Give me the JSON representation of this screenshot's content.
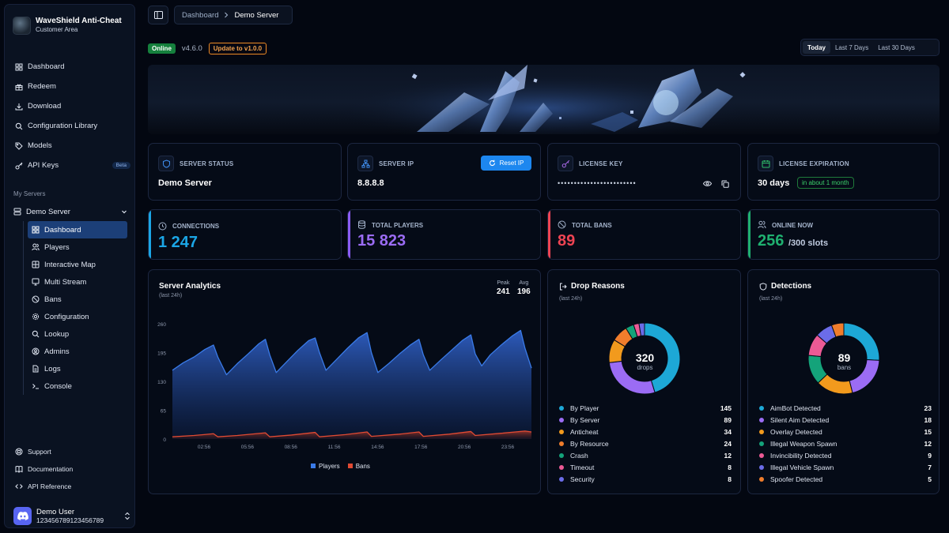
{
  "brand": {
    "title": "WaveShield Anti-Cheat",
    "subtitle": "Customer Area"
  },
  "nav": [
    {
      "label": "Dashboard",
      "icon": "dashboard-icon"
    },
    {
      "label": "Redeem",
      "icon": "gift-icon"
    },
    {
      "label": "Download",
      "icon": "download-icon"
    },
    {
      "label": "Configuration Library",
      "icon": "search-icon"
    },
    {
      "label": "Models",
      "icon": "tag-icon"
    },
    {
      "label": "API Keys",
      "icon": "key-icon",
      "badge": "Beta"
    }
  ],
  "servers": {
    "section_label": "My Servers",
    "server_name": "Demo Server",
    "items": [
      {
        "label": "Dashboard",
        "active": true
      },
      {
        "label": "Players"
      },
      {
        "label": "Interactive Map"
      },
      {
        "label": "Multi Stream"
      },
      {
        "label": "Bans"
      },
      {
        "label": "Configuration"
      },
      {
        "label": "Lookup"
      },
      {
        "label": "Admins"
      },
      {
        "label": "Logs"
      },
      {
        "label": "Console"
      }
    ]
  },
  "bottom_links": [
    {
      "label": "Support"
    },
    {
      "label": "Documentation"
    },
    {
      "label": "API Reference"
    }
  ],
  "user": {
    "name": "Demo User",
    "id": "123456789123456789"
  },
  "breadcrumb": {
    "parent": "Dashboard",
    "current": "Demo Server"
  },
  "status": {
    "online": "Online",
    "version": "v4.6.0",
    "update": "Update to v1.0.0"
  },
  "range": {
    "options": [
      "Today",
      "Last 7 Days",
      "Last 30 Days"
    ],
    "selected": "Today"
  },
  "info_cards": {
    "server_status": {
      "label": "SERVER STATUS",
      "value": "Demo Server"
    },
    "server_ip": {
      "label": "SERVER IP",
      "value": "8.8.8.8",
      "button": "Reset IP"
    },
    "license_key": {
      "label": "LICENSE KEY",
      "masked": "••••••••••••••••••••••••"
    },
    "license_expiration": {
      "label": "LICENSE EXPIRATION",
      "value": "30 days",
      "badge": "in about 1 month"
    }
  },
  "stats": {
    "connections": {
      "label": "CONNECTIONS",
      "value": "1 247",
      "color": "#1ba6e6"
    },
    "total_players": {
      "label": "TOTAL PLAYERS",
      "value": "15 823",
      "color": "#8b5cf6"
    },
    "total_bans": {
      "label": "TOTAL BANS",
      "value": "89",
      "color": "#ef4453"
    },
    "online_now": {
      "label": "ONLINE NOW",
      "value": "256",
      "suffix": "/300 slots",
      "color": "#1fb070"
    }
  },
  "analytics": {
    "title": "Server Analytics",
    "subtitle": "(last 24h)",
    "peak_label": "Peak",
    "peak_value": "241",
    "avg_label": "Avg",
    "avg_value": "196"
  },
  "drop_reasons": {
    "title": "Drop Reasons",
    "subtitle": "(last 24h)",
    "center_value": "320",
    "center_label": "drops",
    "items": [
      {
        "label": "By Player",
        "value": 145,
        "color": "#1da8d6"
      },
      {
        "label": "By Server",
        "value": 89,
        "color": "#9b6cf4"
      },
      {
        "label": "Anticheat",
        "value": 34,
        "color": "#f29a1d"
      },
      {
        "label": "By Resource",
        "value": 24,
        "color": "#f07d2c"
      },
      {
        "label": "Crash",
        "value": 12,
        "color": "#14a37a"
      },
      {
        "label": "Timeout",
        "value": 8,
        "color": "#ec5a95"
      },
      {
        "label": "Security",
        "value": 8,
        "color": "#6b6ce8"
      }
    ]
  },
  "detections": {
    "title": "Detections",
    "subtitle": "(last 24h)",
    "center_value": "89",
    "center_label": "bans",
    "items": [
      {
        "label": "AimBot Detected",
        "value": 23,
        "color": "#1da8d6"
      },
      {
        "label": "Silent Aim Detected",
        "value": 18,
        "color": "#9b6cf4"
      },
      {
        "label": "Overlay Detected",
        "value": 15,
        "color": "#f29a1d"
      },
      {
        "label": "Illegal Weapon Spawn",
        "value": 12,
        "color": "#14a37a"
      },
      {
        "label": "Invincibility Detected",
        "value": 9,
        "color": "#ec5a95"
      },
      {
        "label": "Illegal Vehicle Spawn",
        "value": 7,
        "color": "#6b6ce8"
      },
      {
        "label": "Spoofer Detected",
        "value": 5,
        "color": "#f07d2c"
      }
    ]
  },
  "chart_data": [
    {
      "type": "area",
      "x": [
        "02:56",
        "05:56",
        "08:56",
        "11:56",
        "14:56",
        "17:56",
        "20:56",
        "23:56"
      ],
      "yticks": [
        0,
        65,
        130,
        195,
        260
      ],
      "ylim": [
        0,
        260
      ],
      "legend": "bottom",
      "series": [
        {
          "name": "Players",
          "color": "#3a7be8",
          "points": [
            [
              0,
              155
            ],
            [
              0.5,
              172
            ],
            [
              1,
              185
            ],
            [
              1.5,
              202
            ],
            [
              1.9,
              212
            ],
            [
              2.1,
              185
            ],
            [
              2.5,
              145
            ],
            [
              3,
              170
            ],
            [
              3.5,
              192
            ],
            [
              4,
              215
            ],
            [
              4.3,
              225
            ],
            [
              4.5,
              190
            ],
            [
              4.8,
              150
            ],
            [
              5.3,
              175
            ],
            [
              5.8,
              200
            ],
            [
              6.3,
              222
            ],
            [
              6.6,
              228
            ],
            [
              6.8,
              195
            ],
            [
              7.1,
              155
            ],
            [
              7.6,
              180
            ],
            [
              8.1,
              205
            ],
            [
              8.6,
              228
            ],
            [
              9,
              240
            ],
            [
              9.2,
              195
            ],
            [
              9.5,
              150
            ],
            [
              10,
              170
            ],
            [
              10.5,
              192
            ],
            [
              11,
              212
            ],
            [
              11.4,
              225
            ],
            [
              11.6,
              190
            ],
            [
              11.9,
              155
            ],
            [
              12.4,
              178
            ],
            [
              12.9,
              200
            ],
            [
              13.4,
              222
            ],
            [
              13.8,
              235
            ],
            [
              14,
              192
            ],
            [
              14.3,
              165
            ],
            [
              14.7,
              190
            ],
            [
              15.2,
              212
            ],
            [
              15.7,
              232
            ],
            [
              16.1,
              245
            ],
            [
              16.3,
              205
            ],
            [
              16.6,
              160
            ]
          ]
        },
        {
          "name": "Bans",
          "color": "#e04a33",
          "points": [
            [
              0,
              5
            ],
            [
              1,
              8
            ],
            [
              1.9,
              12
            ],
            [
              2.1,
              5
            ],
            [
              3,
              8
            ],
            [
              4.3,
              14
            ],
            [
              4.5,
              5
            ],
            [
              5.5,
              9
            ],
            [
              6.6,
              15
            ],
            [
              6.8,
              5
            ],
            [
              8,
              10
            ],
            [
              9,
              16
            ],
            [
              9.2,
              6
            ],
            [
              10.5,
              11
            ],
            [
              11.4,
              16
            ],
            [
              11.6,
              6
            ],
            [
              12.8,
              11
            ],
            [
              13.8,
              17
            ],
            [
              14,
              8
            ],
            [
              15.2,
              13
            ],
            [
              16.3,
              18
            ],
            [
              16.6,
              16
            ]
          ]
        }
      ]
    },
    {
      "type": "pie",
      "title": "Drop Reasons",
      "categories": [
        "By Player",
        "By Server",
        "Anticheat",
        "By Resource",
        "Crash",
        "Timeout",
        "Security"
      ],
      "values": [
        145,
        89,
        34,
        24,
        12,
        8,
        8
      ]
    },
    {
      "type": "pie",
      "title": "Detections",
      "categories": [
        "AimBot Detected",
        "Silent Aim Detected",
        "Overlay Detected",
        "Illegal Weapon Spawn",
        "Invincibility Detected",
        "Illegal Vehicle Spawn",
        "Spoofer Detected"
      ],
      "values": [
        23,
        18,
        15,
        12,
        9,
        7,
        5
      ]
    }
  ]
}
